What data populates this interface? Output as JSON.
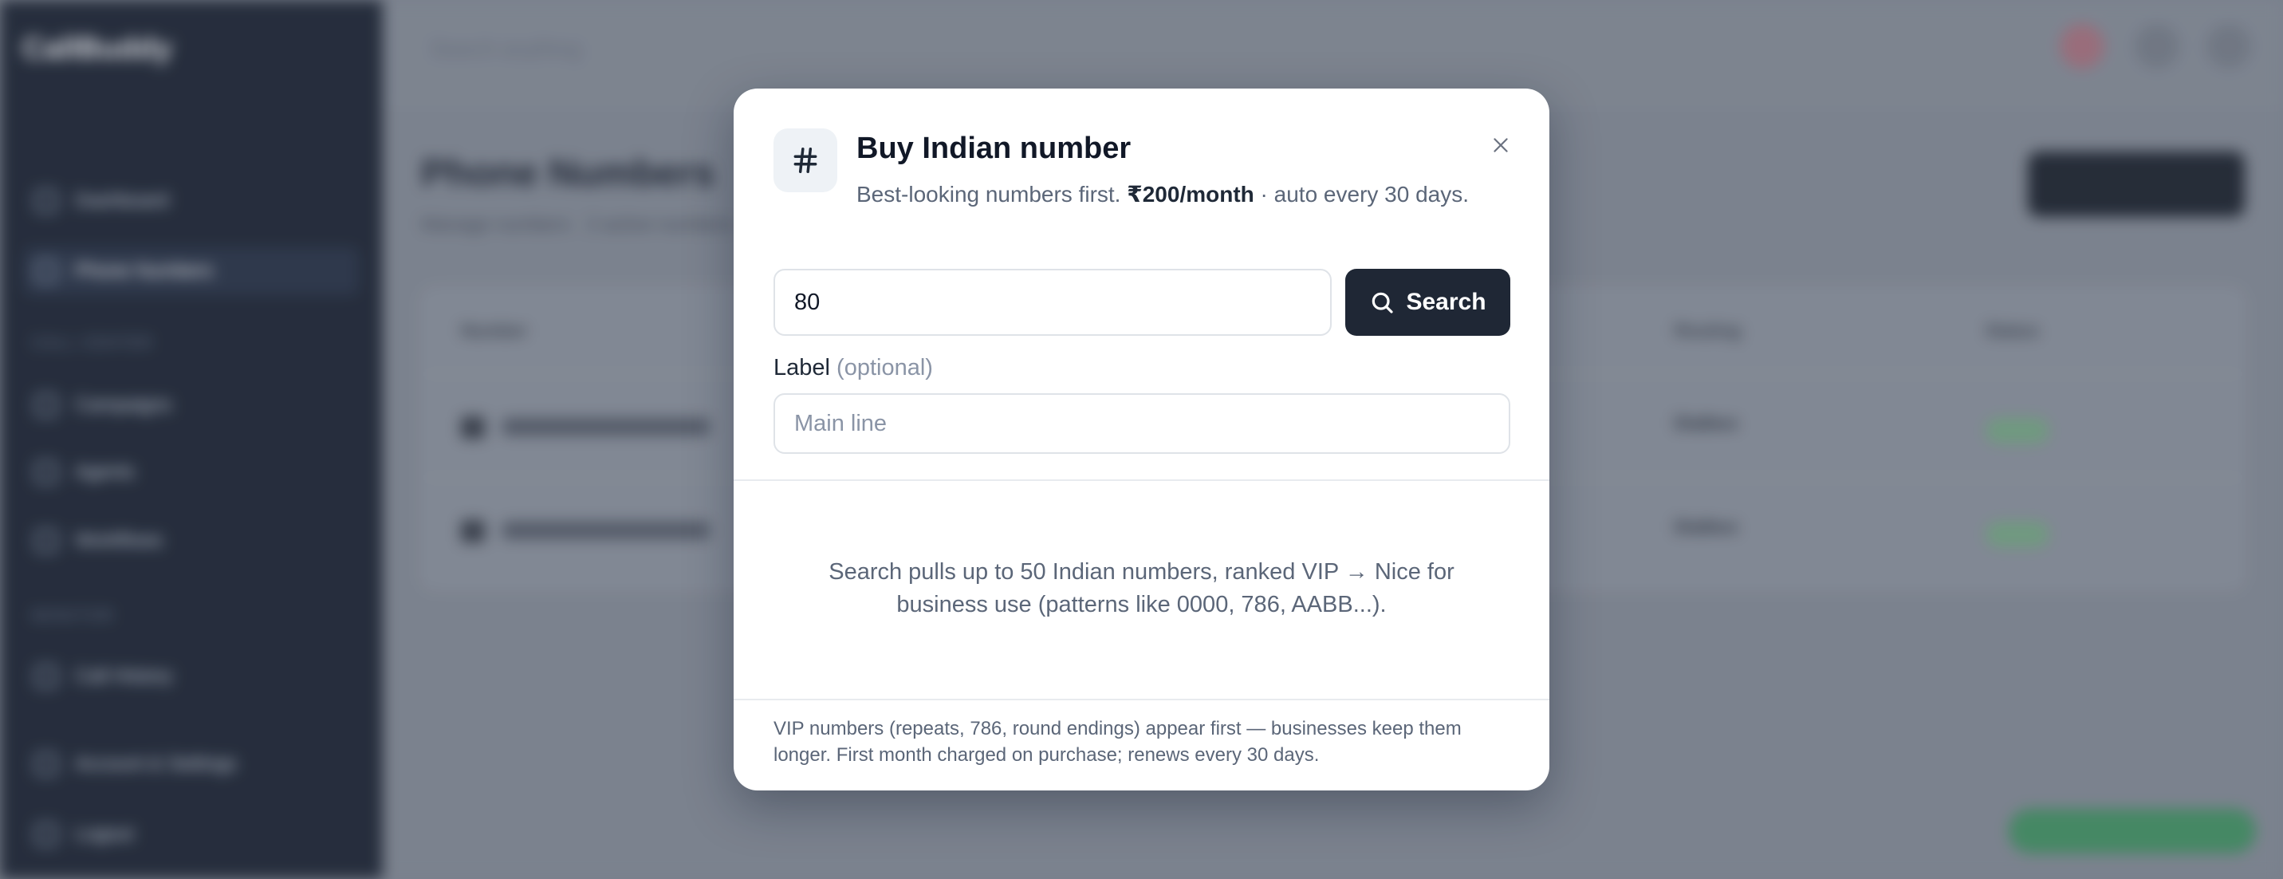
{
  "background": {
    "brand": "CallBuddy",
    "brand_sub": "",
    "nav_items": [
      "Dashboard",
      "Phone Numbers",
      "Campaigns",
      "Agents",
      "Workflows",
      "Call History",
      "Account & Settings",
      "Logout"
    ],
    "section_a": "CALL CENTER",
    "section_b": "MONITOR",
    "top_search": "Search anything",
    "page_title": "Phone Numbers",
    "page_sub": "Manage numbers · 2 active numbers",
    "col_number": "Number",
    "col_agent": "Routing",
    "col_status": "Status",
    "rows": [
      {
        "who": "Dialbox"
      },
      {
        "who": "Dialbox"
      }
    ]
  },
  "modal": {
    "icon": "hash-icon",
    "title": "Buy Indian number",
    "desc_prefix": "Best-looking numbers first. ",
    "price": "₹200/month",
    "desc_suffix": " · auto every 30 days.",
    "search_value": "80",
    "search_button": "Search",
    "label_label": "Label",
    "label_optional": "(optional)",
    "label_placeholder": "Main line",
    "hint": "Search pulls up to 50 Indian numbers, ranked VIP → Nice for business use (patterns like 0000, 786, AABB...).",
    "footer": "VIP numbers (repeats, 786, round endings) appear first — businesses keep them longer. First month charged on purchase; renews every 30 days."
  },
  "colors": {
    "sidebar": "#141c2c",
    "primary": "#1f2735",
    "modal_bg": "#ffffff",
    "muted_text": "#5b6678"
  }
}
